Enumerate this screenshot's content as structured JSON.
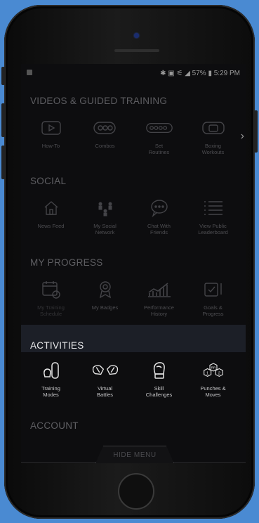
{
  "status_bar": {
    "right_text": "✱ ▣ ⚟ ◢ 57% ▮ 5:29 PM"
  },
  "sections": {
    "videos": {
      "title": "VIDEOS & GUIDED TRAINING",
      "items": [
        {
          "label": "How-To",
          "icon": "play-icon"
        },
        {
          "label": "Combos",
          "icon": "combo-icon"
        },
        {
          "label": "Set\nRoutines",
          "icon": "routine-icon"
        },
        {
          "label": "Boxing\nWorkouts",
          "icon": "workout-icon"
        }
      ],
      "more_icon": "chevron-right-icon"
    },
    "social": {
      "title": "SOCIAL",
      "items": [
        {
          "label": "News Feed",
          "icon": "home-icon"
        },
        {
          "label": "My Social\nNetwork",
          "icon": "network-icon"
        },
        {
          "label": "Chat With\nFriends",
          "icon": "chat-icon"
        },
        {
          "label": "View Public\nLeaderboard",
          "icon": "leaderboard-icon"
        }
      ]
    },
    "progress": {
      "title": "MY PROGRESS",
      "items": [
        {
          "label": "My Training\nSchedule",
          "icon": "calendar-icon"
        },
        {
          "label": "My Badges",
          "icon": "badge-icon"
        },
        {
          "label": "Performance\nHistory",
          "icon": "chart-icon"
        },
        {
          "label": "Goals &\nProgress",
          "icon": "goals-icon"
        }
      ]
    },
    "activities": {
      "title": "ACTIVITIES",
      "items": [
        {
          "label": "Training\nModes",
          "icon": "glove-bag-icon"
        },
        {
          "label": "Virtual\nBattles",
          "icon": "gloves-icon"
        },
        {
          "label": "Skill\nChallenges",
          "icon": "glove-icon"
        },
        {
          "label": "Punches &\nMoves",
          "icon": "hex-numbers-icon",
          "badges": [
            "1",
            "RR",
            "2"
          ]
        }
      ]
    },
    "account": {
      "title": "ACCOUNT"
    }
  },
  "hide_menu_label": "HIDE MENU",
  "colors": {
    "background": "#4a8ad2",
    "screen": "#0d0d0f",
    "active_band": "#1c1f27"
  }
}
